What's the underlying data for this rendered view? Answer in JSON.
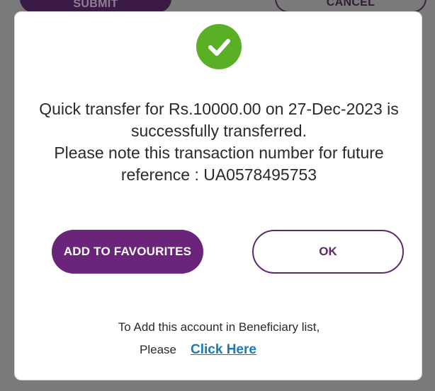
{
  "background": {
    "submit_label": "SUBMIT",
    "cancel_label": "CANCEL"
  },
  "dialog": {
    "icon": "check-circle-icon",
    "message_lines": [
      "Quick transfer for Rs.10000.00 on 27-Dec-2023 is",
      "successfully transferred.",
      "Please note this transaction number for future",
      "reference : UA0578495753"
    ],
    "add_favourites_label": "ADD TO FAVOURITES",
    "ok_label": "OK",
    "beneficiary_text": "To Add this account in Beneficiary list,",
    "please_text": "Please",
    "click_here_label": "Click Here"
  },
  "colors": {
    "primary_purple": "#6a2479",
    "success_green": "#5ab025",
    "link_blue": "#1a7ab8",
    "overlay_gray": "#7a7a7a"
  }
}
